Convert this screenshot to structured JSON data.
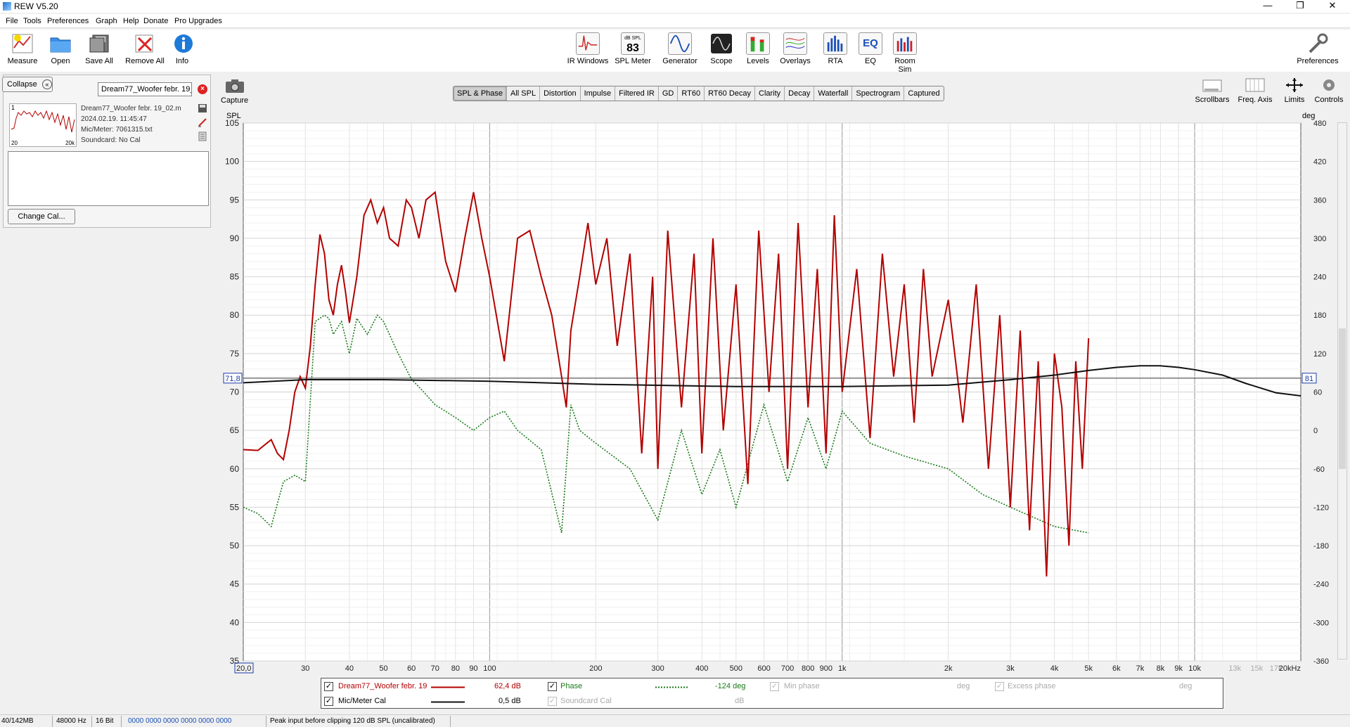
{
  "window": {
    "title": "REW V5.20",
    "minimize": "—",
    "restore": "❐",
    "close": "✕"
  },
  "menu": [
    "File",
    "Tools",
    "Preferences",
    "Graph",
    "Help",
    "Donate",
    "Pro Upgrades"
  ],
  "toolbar": {
    "measure": "Measure",
    "open": "Open",
    "save_all": "Save All",
    "remove_all": "Remove All",
    "info": "Info",
    "ir_windows": "IR Windows",
    "spl_meter": "SPL Meter",
    "spl_meter_caption": "dB SPL",
    "spl_meter_value": "83",
    "generator": "Generator",
    "scope": "Scope",
    "levels": "Levels",
    "overlays": "Overlays",
    "rta": "RTA",
    "eq": "EQ",
    "eq_icon_text": "EQ",
    "room_sim": "Room Sim",
    "preferences": "Preferences"
  },
  "panel": {
    "collapse": "Collapse",
    "name_value": "Dream77_Woofer febr. 19_02.m",
    "index": "1",
    "thumb_left": "20",
    "thumb_right": "20k",
    "meas_name": "Dream77_Woofer febr. 19_02.m",
    "date": "2024.02.19. 11:45:47",
    "mic": "Mic/Meter: 7061315.txt",
    "soundcard": "Soundcard: No Cal",
    "change_cal": "Change Cal..."
  },
  "capture": "Capture",
  "tabs": [
    "SPL & Phase",
    "All SPL",
    "Distortion",
    "Impulse",
    "Filtered IR",
    "GD",
    "RT60",
    "RT60 Decay",
    "Clarity",
    "Decay",
    "Waterfall",
    "Spectrogram",
    "Captured"
  ],
  "active_tab": "SPL & Phase",
  "graph_controls": {
    "scrollbars": "Scrollbars",
    "freq_axis": "Freq. Axis",
    "limits": "Limits",
    "controls": "Controls"
  },
  "colors": {
    "spl": "#b30000",
    "phase": "#1a7a1a",
    "cal": "#111111",
    "cursor_box": "#1e3ca8"
  },
  "chart_data": {
    "type": "line",
    "xscale": "log",
    "xlim": [
      20,
      20000
    ],
    "ylim_left": [
      35,
      105
    ],
    "ylim_right": [
      -360,
      480
    ],
    "ylabel_left": "SPL",
    "ylabel_right": "deg",
    "grid": true,
    "x_ticks": [
      {
        "v": 20,
        "l": "20,0"
      },
      {
        "v": 30,
        "l": "30"
      },
      {
        "v": 40,
        "l": "40"
      },
      {
        "v": 50,
        "l": "50"
      },
      {
        "v": 60,
        "l": "60"
      },
      {
        "v": 70,
        "l": "70"
      },
      {
        "v": 80,
        "l": "80"
      },
      {
        "v": 90,
        "l": "90"
      },
      {
        "v": 100,
        "l": "100"
      },
      {
        "v": 200,
        "l": "200"
      },
      {
        "v": 300,
        "l": "300"
      },
      {
        "v": 400,
        "l": "400"
      },
      {
        "v": 500,
        "l": "500"
      },
      {
        "v": 600,
        "l": "600"
      },
      {
        "v": 700,
        "l": "700"
      },
      {
        "v": 800,
        "l": "800"
      },
      {
        "v": 900,
        "l": "900"
      },
      {
        "v": 1000,
        "l": "1k"
      },
      {
        "v": 2000,
        "l": "2k"
      },
      {
        "v": 3000,
        "l": "3k"
      },
      {
        "v": 4000,
        "l": "4k"
      },
      {
        "v": 5000,
        "l": "5k"
      },
      {
        "v": 6000,
        "l": "6k"
      },
      {
        "v": 7000,
        "l": "7k"
      },
      {
        "v": 8000,
        "l": "8k"
      },
      {
        "v": 9000,
        "l": "9k"
      },
      {
        "v": 10000,
        "l": "10k"
      },
      {
        "v": 13000,
        "l": "13k"
      },
      {
        "v": 15000,
        "l": "15k"
      },
      {
        "v": 17000,
        "l": "17k"
      },
      {
        "v": 20000,
        "l": "20kHz"
      }
    ],
    "y_ticks_left": [
      35,
      40,
      45,
      50,
      55,
      60,
      65,
      70,
      75,
      80,
      85,
      90,
      95,
      100,
      105
    ],
    "y_ticks_right": [
      -360,
      -300,
      -240,
      -180,
      -120,
      -60,
      0,
      60,
      120,
      180,
      240,
      300,
      360,
      420,
      480
    ],
    "cursor": {
      "left_value": "71,8",
      "right_value": "81",
      "y": 71.8
    },
    "series": [
      {
        "name": "Dream77_Woofer febr. 19",
        "axis": "left",
        "legend_value": "62,4 dB",
        "x": [
          20,
          22,
          24,
          25,
          26,
          27,
          28,
          29,
          30,
          31,
          32,
          33,
          34,
          35,
          36,
          37,
          38,
          39,
          40,
          42,
          44,
          46,
          48,
          50,
          52,
          55,
          58,
          60,
          63,
          66,
          70,
          75,
          80,
          85,
          90,
          95,
          100,
          110,
          120,
          130,
          140,
          150,
          160,
          165,
          170,
          180,
          190,
          200,
          215,
          230,
          250,
          270,
          290,
          300,
          320,
          350,
          380,
          400,
          430,
          460,
          500,
          540,
          580,
          620,
          660,
          700,
          750,
          800,
          850,
          900,
          950,
          1000,
          1100,
          1200,
          1300,
          1400,
          1500,
          1600,
          1700,
          1800,
          2000,
          2200,
          2400,
          2600,
          2800,
          3000,
          3200,
          3400,
          3600,
          3800,
          4000,
          4200,
          4400,
          4600,
          4800,
          5000
        ],
        "y": [
          62.5,
          62.4,
          63.8,
          62,
          61.2,
          65,
          70,
          72,
          70.5,
          76,
          84,
          90.5,
          88,
          82,
          80,
          84,
          86.5,
          83,
          79,
          85,
          93,
          95,
          92,
          94,
          90,
          89,
          95,
          94,
          90,
          95,
          96,
          87,
          83,
          90,
          96,
          90,
          85,
          74,
          90,
          91,
          85,
          80,
          72,
          68,
          78,
          85,
          92,
          84,
          90,
          76,
          88,
          62,
          85,
          60,
          91,
          68,
          88,
          62,
          90,
          65,
          84,
          58,
          91,
          70,
          88,
          60,
          92,
          68,
          86,
          62,
          93,
          70,
          86,
          64,
          88,
          72,
          84,
          66,
          86,
          72,
          82,
          66,
          84,
          60,
          80,
          55,
          78,
          52,
          74,
          46,
          75,
          68,
          50,
          74,
          60,
          77
        ]
      },
      {
        "name": "Phase",
        "axis": "right",
        "legend_value": "-124 deg",
        "x": [
          20,
          22,
          24,
          26,
          28,
          30,
          32,
          34,
          35,
          36,
          38,
          40,
          42,
          45,
          48,
          50,
          55,
          60,
          65,
          70,
          80,
          90,
          100,
          110,
          120,
          140,
          160,
          170,
          180,
          200,
          250,
          300,
          350,
          400,
          450,
          500,
          600,
          700,
          800,
          900,
          1000,
          1200,
          1500,
          2000,
          2500,
          3000,
          4000,
          5000
        ],
        "y": [
          -120,
          -130,
          -150,
          -80,
          -70,
          -80,
          170,
          180,
          175,
          150,
          170,
          120,
          175,
          150,
          180,
          170,
          120,
          80,
          60,
          40,
          20,
          0,
          20,
          30,
          0,
          -30,
          -160,
          40,
          0,
          -20,
          -60,
          -140,
          0,
          -100,
          -30,
          -120,
          40,
          -80,
          20,
          -60,
          30,
          -20,
          -40,
          -60,
          -100,
          -120,
          -150,
          -160
        ]
      },
      {
        "name": "Mic/Meter Cal",
        "axis": "left",
        "legend_value": "0,5 dB",
        "x": [
          20,
          30,
          50,
          100,
          200,
          500,
          1000,
          2000,
          3000,
          4000,
          5000,
          6000,
          7000,
          8000,
          9000,
          10000,
          12000,
          14000,
          17000,
          20000
        ],
        "y": [
          71.2,
          71.6,
          71.6,
          71.4,
          71.0,
          70.7,
          70.7,
          70.9,
          71.6,
          72.2,
          72.8,
          73.2,
          73.4,
          73.4,
          73.2,
          72.9,
          72.2,
          71.1,
          69.9,
          69.5
        ]
      }
    ]
  },
  "legend": {
    "series1_name": "Dream77_Woofer febr. 19",
    "series1_value": "62,4 dB",
    "phase_label": "Phase",
    "phase_value": "-124 deg",
    "min_phase": "Min phase",
    "min_phase_unit": "deg",
    "excess_phase": "Excess phase",
    "excess_phase_unit": "deg",
    "cal_name": "Mic/Meter Cal",
    "cal_value": "0,5 dB",
    "soundcard_cal": "Soundcard Cal",
    "soundcard_unit": "dB"
  },
  "status": {
    "memory": "40/142MB",
    "rate": "48000 Hz",
    "bits": "16 Bit",
    "levels": "0000 0000  0000 0000  0000 0000",
    "message": "Peak input before clipping 120 dB SPL (uncalibrated)"
  }
}
